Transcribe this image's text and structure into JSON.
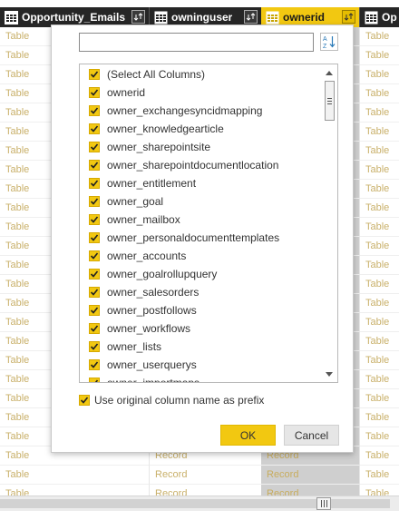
{
  "grid": {
    "headers": [
      {
        "label": "Opportunity_Emails",
        "icon": "table-icon"
      },
      {
        "label": "owninguser",
        "icon": "table-icon"
      },
      {
        "label": "ownerid",
        "icon": "table-icon",
        "selected": true
      },
      {
        "label": "Op",
        "icon": "table-icon"
      }
    ],
    "rows": [
      [
        "Table",
        "",
        "",
        "Table"
      ],
      [
        "Table",
        "",
        "",
        "Table"
      ],
      [
        "Table",
        "",
        "",
        "Table"
      ],
      [
        "Table",
        "",
        "",
        "Table"
      ],
      [
        "Table",
        "",
        "",
        "Table"
      ],
      [
        "Table",
        "",
        "",
        "Table"
      ],
      [
        "Table",
        "",
        "",
        "Table"
      ],
      [
        "Table",
        "",
        "",
        "Table"
      ],
      [
        "Table",
        "",
        "",
        "Table"
      ],
      [
        "Table",
        "",
        "",
        "Table"
      ],
      [
        "Table",
        "",
        "",
        "Table"
      ],
      [
        "Table",
        "",
        "",
        "Table"
      ],
      [
        "Table",
        "",
        "",
        "Table"
      ],
      [
        "Table",
        "",
        "",
        "Table"
      ],
      [
        "Table",
        "",
        "",
        "Table"
      ],
      [
        "Table",
        "",
        "",
        "Table"
      ],
      [
        "Table",
        "",
        "",
        "Table"
      ],
      [
        "Table",
        "",
        "",
        "Table"
      ],
      [
        "Table",
        "",
        "",
        "Table"
      ],
      [
        "Table",
        "",
        "",
        "Table"
      ],
      [
        "Table",
        "",
        "",
        "Table"
      ],
      [
        "Table",
        "",
        "",
        "Table"
      ],
      [
        "Table",
        "Record",
        "Record",
        "Table"
      ],
      [
        "Table",
        "Record",
        "Record",
        "Table"
      ],
      [
        "Table",
        "Record",
        "Record",
        "Table"
      ]
    ],
    "colors": {
      "header_bg": "#262626",
      "header_selected_bg": "#f2c811",
      "cell_text": "#c9b06a",
      "selected_col_bg": "#cfcfcf"
    }
  },
  "dialog": {
    "search_value": "",
    "sort_icon": "sort-az-icon",
    "columns": [
      {
        "label": "(Select All Columns)",
        "checked": true
      },
      {
        "label": "ownerid",
        "checked": true
      },
      {
        "label": "owner_exchangesyncidmapping",
        "checked": true
      },
      {
        "label": "owner_knowledgearticle",
        "checked": true
      },
      {
        "label": "owner_sharepointsite",
        "checked": true
      },
      {
        "label": "owner_sharepointdocumentlocation",
        "checked": true
      },
      {
        "label": "owner_entitlement",
        "checked": true
      },
      {
        "label": "owner_goal",
        "checked": true
      },
      {
        "label": "owner_mailbox",
        "checked": true
      },
      {
        "label": "owner_personaldocumenttemplates",
        "checked": true
      },
      {
        "label": "owner_accounts",
        "checked": true
      },
      {
        "label": "owner_goalrollupquery",
        "checked": true
      },
      {
        "label": "owner_salesorders",
        "checked": true
      },
      {
        "label": "owner_postfollows",
        "checked": true
      },
      {
        "label": "owner_workflows",
        "checked": true
      },
      {
        "label": "owner_lists",
        "checked": true
      },
      {
        "label": "owner_userquerys",
        "checked": true
      },
      {
        "label": "owner_importmaps",
        "checked": true
      }
    ],
    "prefix_label": "Use original column name as prefix",
    "prefix_checked": true,
    "ok_label": "OK",
    "cancel_label": "Cancel",
    "accent": "#f2c811"
  }
}
